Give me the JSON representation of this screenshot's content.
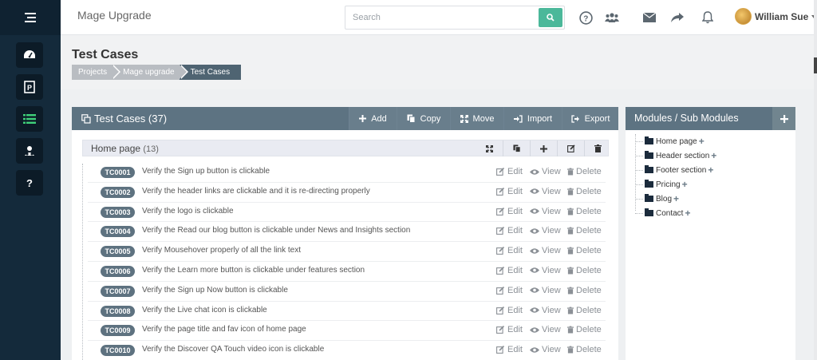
{
  "app": {
    "title": "Mage Upgrade"
  },
  "search": {
    "placeholder": "Search"
  },
  "user": {
    "name": "William Sue"
  },
  "page": {
    "title": "Test Cases",
    "breadcrumb": [
      "Projects",
      "Mage upgrade",
      "Test Cases"
    ]
  },
  "panel": {
    "title": "Test Cases (37)",
    "buttons": {
      "add": "Add",
      "copy": "Copy",
      "move": "Move",
      "import": "Import",
      "export": "Export"
    }
  },
  "module": {
    "name": "Home page",
    "count": "(13)"
  },
  "actions": {
    "edit": "Edit",
    "view": "View",
    "delete": "Delete"
  },
  "test_cases": [
    {
      "id": "TC0001",
      "title": "Verify the Sign up button is clickable"
    },
    {
      "id": "TC0002",
      "title": "Verify the header links are clickable and it is re-directing properly"
    },
    {
      "id": "TC0003",
      "title": "Verify the logo is clickable"
    },
    {
      "id": "TC0004",
      "title": "Verify the Read our blog button is clickable under News and Insights section"
    },
    {
      "id": "TC0005",
      "title": "Verify Mousehover properly of all the link text"
    },
    {
      "id": "TC0006",
      "title": "Verify the Learn more button is clickable under features section"
    },
    {
      "id": "TC0007",
      "title": "Verify the Sign up Now button is clickable"
    },
    {
      "id": "TC0008",
      "title": "Verify the Live chat icon is clickable"
    },
    {
      "id": "TC0009",
      "title": "Verify the page title and fav icon of home page"
    },
    {
      "id": "TC0010",
      "title": "Verify the Discover QA Touch video icon is clickable"
    }
  ],
  "modules_panel": {
    "title": "Modules / Sub Modules",
    "items": [
      "Home page",
      "Header section",
      "Footer section",
      "Pricing",
      "Blog",
      "Contact"
    ]
  },
  "colors": {
    "sidebar": "#142a3b",
    "header_bar": "#5d7382",
    "search_button": "#4bb89a",
    "active_nav_icon": "#3fd07a",
    "tc_badge": "#5e7280"
  },
  "icons": {
    "sidebar": [
      "menu-icon",
      "dashboard-icon",
      "project-icon",
      "test-cases-list-icon",
      "users-icon",
      "help-icon"
    ],
    "topbar": [
      "search-icon",
      "help-circle-icon",
      "users-icon",
      "mail-icon",
      "share-icon",
      "bell-icon"
    ]
  }
}
